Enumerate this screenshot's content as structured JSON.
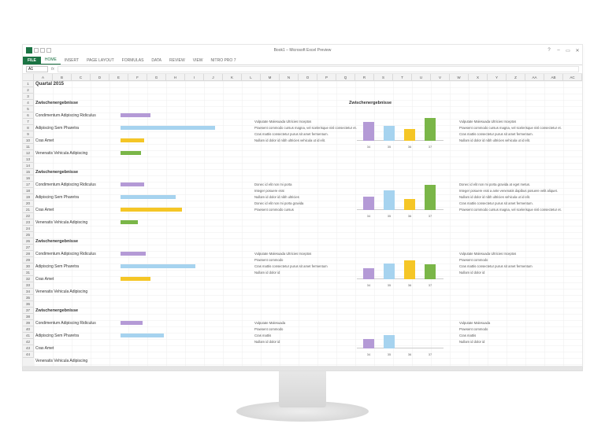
{
  "window": {
    "title": "Book1 – Microsoft Excel Preview",
    "min": "‒",
    "max": "▭",
    "close": "✕",
    "help": "?"
  },
  "ribbon": {
    "file": "FILE",
    "tabs": [
      "HOME",
      "INSERT",
      "PAGE LAYOUT",
      "FORMULAS",
      "DATA",
      "REVIEW",
      "VIEW",
      "NITRO PRO 7"
    ]
  },
  "fbar": {
    "namebox": "A1",
    "fx": "fx"
  },
  "columns": [
    "A",
    "B",
    "C",
    "D",
    "E",
    "F",
    "G",
    "H",
    "I",
    "J",
    "K",
    "L",
    "M",
    "N",
    "O",
    "P",
    "Q",
    "R",
    "S",
    "T",
    "U",
    "V",
    "W",
    "X",
    "Y",
    "Z",
    "AA",
    "AB",
    "AC"
  ],
  "sheet": {
    "title": "Quartal 2015",
    "section": "Zwischenergebnisse",
    "rows": [
      "Condimentum Adipiscing Ridiculus",
      "Adipiscing Sem Pharetra",
      "Cras Amet",
      "Venenatis Vehicula Adipiscing"
    ],
    "right_heading": "Zwischenergebnisse",
    "textblock1": [
      "Vulputate Malesuada Ultricies Inceptos",
      "Praesent commodo cursus magna, vel scelerisque nisl consectetur et.",
      "Cras mattis consectetur purus sit amet fermentum.",
      "Nullam id dolor id nibh ultricies vehicula ut id elit."
    ],
    "textblock2": [
      "Donec id elit non mi porta",
      "Integer posuere erat",
      "Nullam id dolor id nibh ultricies",
      "Donec id elit non mi porta gravida",
      "Praesent commodo cursus"
    ],
    "textblock2r": [
      "Donec id elit non mi porta gravida at eget metus.",
      "Integer posuere erat a ante venenatis dapibus posuere velit aliquet.",
      "Nullam id dolor id nibh ultricies vehicula ut id elit.",
      "Cras mattis consectetur purus sit amet fermentum.",
      "Praesent commodo cursus magna, vel scelerisque nisl consectetur et."
    ],
    "textblock3": [
      "Vulputate Malesuada Ultricies Inceptos",
      "Praesent commodo",
      "Cras mattis consectetur purus sit amet fermentum",
      "Nullam id dolor id"
    ],
    "textblock4": [
      "Vulputate Malesuada",
      "Praesent commodo",
      "Cras mattis",
      "Nullam id dolor id"
    ]
  },
  "chart_data": [
    {
      "type": "bar-horizontal",
      "title": "Zwischenergebnisse group 1",
      "categories": [
        "Condimentum Adipiscing Ridiculus",
        "Adipiscing Sem Pharetra",
        "Cras Amet",
        "Venenatis Vehicula Adipiscing"
      ],
      "series": [
        {
          "name": "purple",
          "values": [
            38,
            0,
            0,
            0
          ]
        },
        {
          "name": "blue",
          "values": [
            0,
            120,
            0,
            0
          ]
        },
        {
          "name": "yellow",
          "values": [
            0,
            0,
            30,
            0
          ]
        },
        {
          "name": "green",
          "values": [
            0,
            0,
            0,
            26
          ]
        }
      ]
    },
    {
      "type": "bar-horizontal",
      "title": "Zwischenergebnisse group 2",
      "categories": [
        "Condimentum Adipiscing Ridiculus",
        "Adipiscing Sem Pharetra",
        "Cras Amet",
        "Venenatis Vehicula Adipiscing"
      ],
      "series": [
        {
          "name": "purple",
          "values": [
            30,
            0,
            0,
            0
          ]
        },
        {
          "name": "blue",
          "values": [
            0,
            70,
            0,
            0
          ]
        },
        {
          "name": "yellow",
          "values": [
            0,
            0,
            78,
            0
          ]
        },
        {
          "name": "green",
          "values": [
            0,
            0,
            0,
            22
          ]
        }
      ]
    },
    {
      "type": "bar-horizontal",
      "title": "Zwischenergebnisse group 3",
      "categories": [
        "Condimentum Adipiscing Ridiculus",
        "Adipiscing Sem Pharetra",
        "Cras Amet",
        "Venenatis Vehicula Adipiscing"
      ],
      "series": [
        {
          "name": "purple",
          "values": [
            32,
            0,
            0,
            0
          ]
        },
        {
          "name": "blue",
          "values": [
            0,
            95,
            0,
            0
          ]
        },
        {
          "name": "yellow",
          "values": [
            0,
            0,
            38,
            0
          ]
        },
        {
          "name": "green",
          "values": [
            0,
            0,
            0,
            0
          ]
        }
      ]
    },
    {
      "type": "bar-horizontal",
      "title": "Zwischenergebnisse group 4",
      "categories": [
        "Condimentum Adipiscing Ridiculus",
        "Adipiscing Sem Pharetra",
        "Cras Amet",
        "Venenatis Vehicula Adipiscing"
      ],
      "series": [
        {
          "name": "purple",
          "values": [
            28,
            0,
            0,
            0
          ]
        },
        {
          "name": "blue",
          "values": [
            0,
            55,
            0,
            0
          ]
        },
        {
          "name": "yellow",
          "values": [
            0,
            0,
            0,
            0
          ]
        },
        {
          "name": "green",
          "values": [
            0,
            0,
            0,
            0
          ]
        }
      ]
    },
    {
      "type": "bar",
      "categories": [
        "34",
        "35",
        "36",
        "37"
      ],
      "series": [
        {
          "name": "purple",
          "values": [
            28,
            0,
            0,
            0
          ]
        },
        {
          "name": "blue",
          "values": [
            0,
            22,
            0,
            0
          ]
        },
        {
          "name": "yellow",
          "values": [
            0,
            0,
            18,
            0
          ]
        },
        {
          "name": "green",
          "values": [
            0,
            0,
            0,
            34
          ]
        }
      ],
      "ylim": [
        0,
        40
      ]
    },
    {
      "type": "bar",
      "categories": [
        "34",
        "35",
        "36",
        "37"
      ],
      "series": [
        {
          "name": "purple",
          "values": [
            20,
            0,
            0,
            0
          ]
        },
        {
          "name": "blue",
          "values": [
            0,
            30,
            0,
            0
          ]
        },
        {
          "name": "yellow",
          "values": [
            0,
            0,
            16,
            0
          ]
        },
        {
          "name": "green",
          "values": [
            0,
            0,
            0,
            38
          ]
        }
      ],
      "ylim": [
        0,
        40
      ]
    },
    {
      "type": "bar",
      "categories": [
        "34",
        "35",
        "36",
        "37"
      ],
      "series": [
        {
          "name": "purple",
          "values": [
            16,
            0,
            0,
            0
          ]
        },
        {
          "name": "blue",
          "values": [
            0,
            24,
            0,
            0
          ]
        },
        {
          "name": "yellow",
          "values": [
            0,
            0,
            28,
            0
          ]
        },
        {
          "name": "green",
          "values": [
            0,
            0,
            0,
            22
          ]
        }
      ],
      "ylim": [
        0,
        40
      ]
    },
    {
      "type": "bar",
      "categories": [
        "34",
        "35",
        "36",
        "37"
      ],
      "series": [
        {
          "name": "purple",
          "values": [
            14,
            0,
            0,
            0
          ]
        },
        {
          "name": "blue",
          "values": [
            0,
            20,
            0,
            0
          ]
        },
        {
          "name": "yellow",
          "values": [
            0,
            0,
            0,
            0
          ]
        },
        {
          "name": "green",
          "values": [
            0,
            0,
            0,
            0
          ]
        }
      ],
      "ylim": [
        0,
        40
      ]
    }
  ]
}
